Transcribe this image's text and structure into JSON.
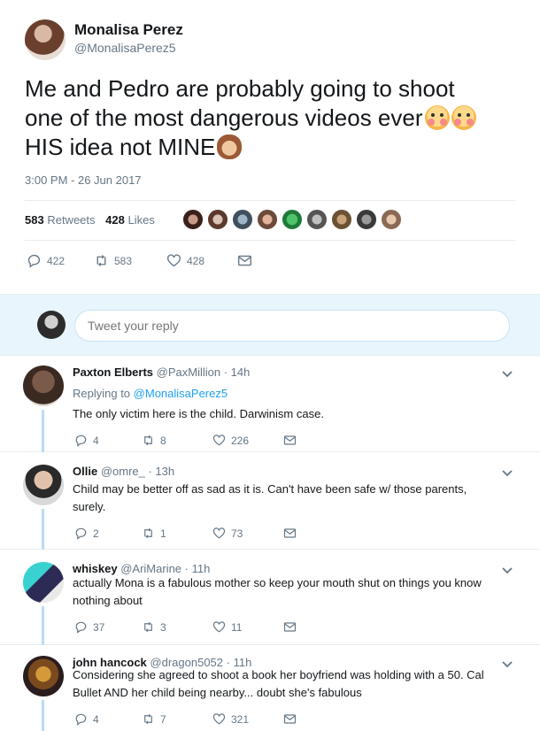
{
  "tweet": {
    "author_name": "Monalisa Perez",
    "author_handle": "@MonalisaPerez5",
    "text_line1": "Me and Pedro are probably going to shoot",
    "text_line2": "one of the most dangerous videos ever",
    "text_line3": "HIS idea not MINE",
    "emojis": [
      "flushed-face-emoji",
      "flushed-face-emoji",
      "see-no-evil-monkey-emoji"
    ],
    "timestamp": "3:00 PM - 26 Jun 2017",
    "retweets_count": "583",
    "retweets_label": "Retweets",
    "likes_count": "428",
    "likes_label": "Likes",
    "actions": {
      "replies": "422",
      "retweets": "583",
      "likes": "428"
    }
  },
  "reply_box": {
    "placeholder": "Tweet your reply"
  },
  "replies": [
    {
      "name": "Paxton Elberts",
      "handle": "@PaxMillion",
      "time": "· 14h",
      "replying_prefix": "Replying to",
      "replying_to": "@MonalisaPerez5",
      "text": "The only victim here is the child. Darwinism case.",
      "counts": {
        "replies": "4",
        "retweets": "8",
        "likes": "226"
      }
    },
    {
      "name": "Ollie",
      "handle": "@omre_",
      "time": "· 13h",
      "text": "Child may be better off as sad as it is. Can't have been safe w/ those parents, surely.",
      "counts": {
        "replies": "2",
        "retweets": "1",
        "likes": "73"
      }
    },
    {
      "name": "whiskey",
      "handle": "@AriMarine",
      "time": "· 11h",
      "text": "actually Mona is a fabulous mother so keep your mouth shut on things you know nothing about",
      "counts": {
        "replies": "37",
        "retweets": "3",
        "likes": "11"
      }
    },
    {
      "name": "john hancock",
      "handle": "@dragon5052",
      "time": "· 11h",
      "text": "Considering she agreed to shoot a book her boyfriend was holding with a 50. Cal Bullet AND her child being nearby... doubt she's fabulous",
      "counts": {
        "replies": "4",
        "retweets": "7",
        "likes": "321"
      }
    }
  ],
  "icons": {
    "reply": "reply-icon",
    "retweet": "retweet-icon",
    "like": "heart-icon",
    "message": "envelope-icon",
    "more": "chevron-down-icon"
  },
  "colors": {
    "accent": "#1da1f2",
    "muted": "#657786",
    "reply_bg": "#e8f5fd",
    "thread_line": "#b9dcf3"
  }
}
